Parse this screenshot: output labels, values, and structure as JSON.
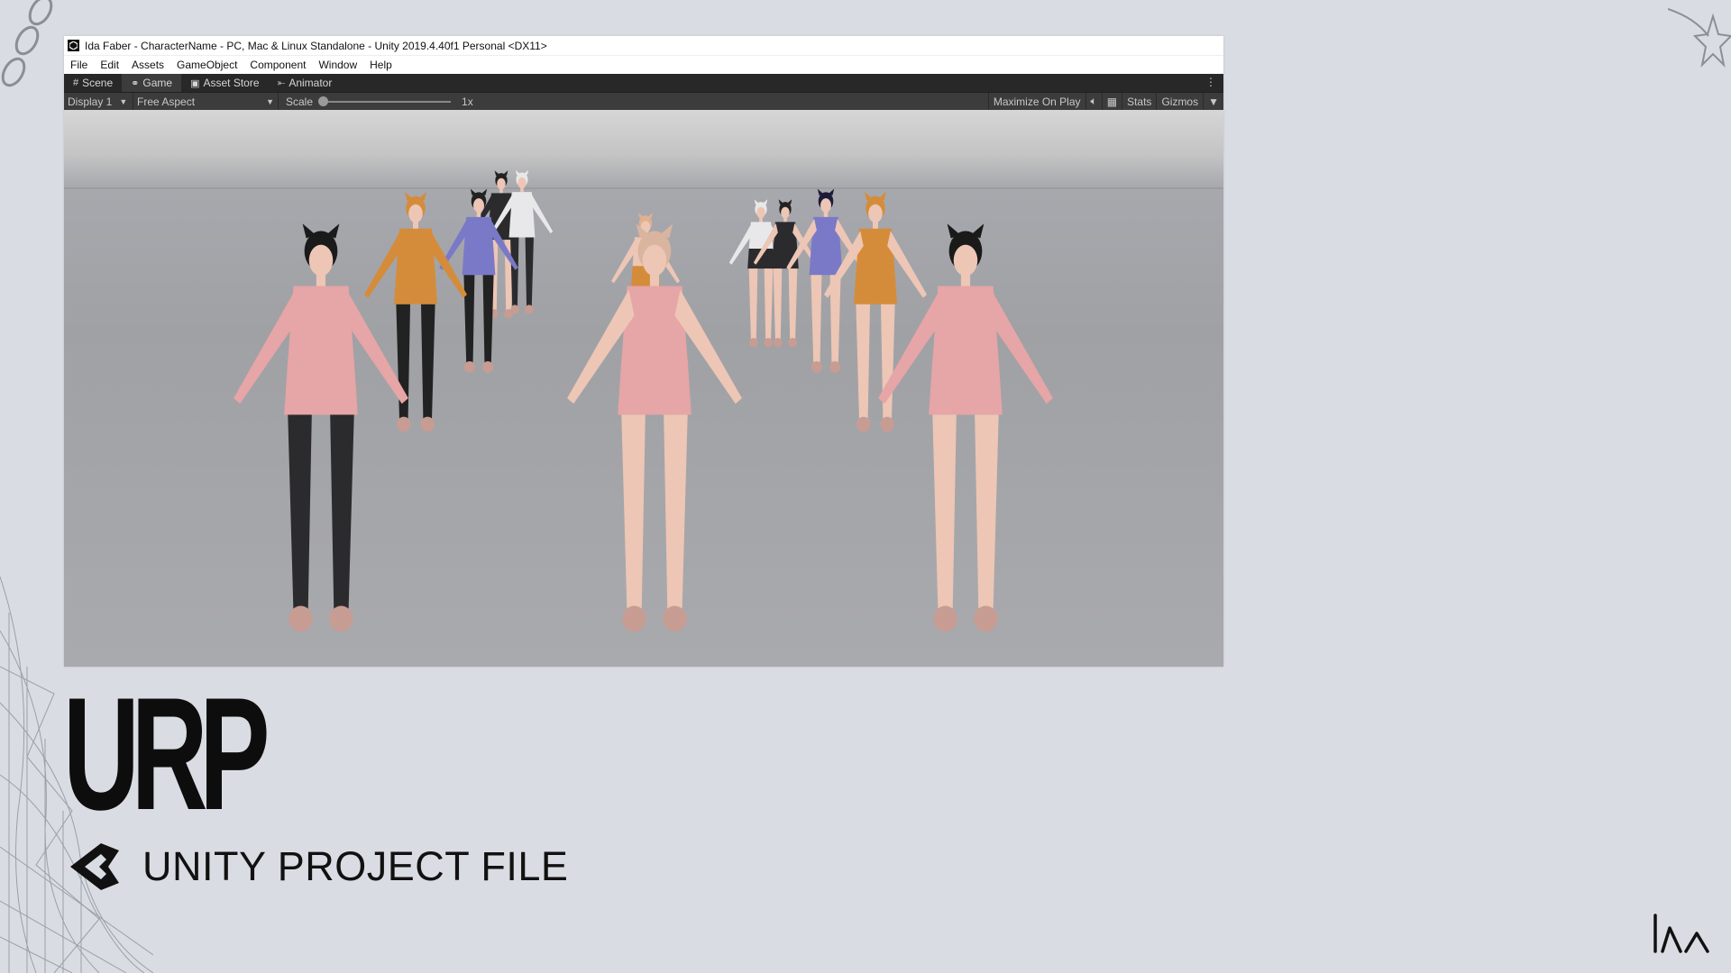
{
  "window": {
    "title": "Ida Faber - CharacterName - PC, Mac & Linux Standalone - Unity 2019.4.40f1 Personal <DX11>"
  },
  "menu": [
    "File",
    "Edit",
    "Assets",
    "GameObject",
    "Component",
    "Window",
    "Help"
  ],
  "tabs": [
    {
      "label": "Scene",
      "icon": "grid-icon"
    },
    {
      "label": "Game",
      "icon": "gamepad-icon"
    },
    {
      "label": "Asset Store",
      "icon": "shopping-bag-icon"
    },
    {
      "label": "Animator",
      "icon": "animator-icon"
    }
  ],
  "toolbar": {
    "display": "Display 1",
    "aspect": "Free Aspect",
    "scale_label": "Scale",
    "scale_value": "1x",
    "maximize": "Maximize On Play",
    "stats": "Stats",
    "gizmos": "Gizmos"
  },
  "headline": "URP",
  "subtitle": "UNITY PROJECT FILE",
  "colors": {
    "background": "#d9dde3",
    "pink_outfit": "#e6a5a6",
    "orange_outfit": "#d58c3a",
    "purple_outfit": "#7a79c8",
    "black_outfit": "#2b2b2d",
    "white_outfit": "#e8e8ea",
    "skin": "#edc6b5"
  }
}
